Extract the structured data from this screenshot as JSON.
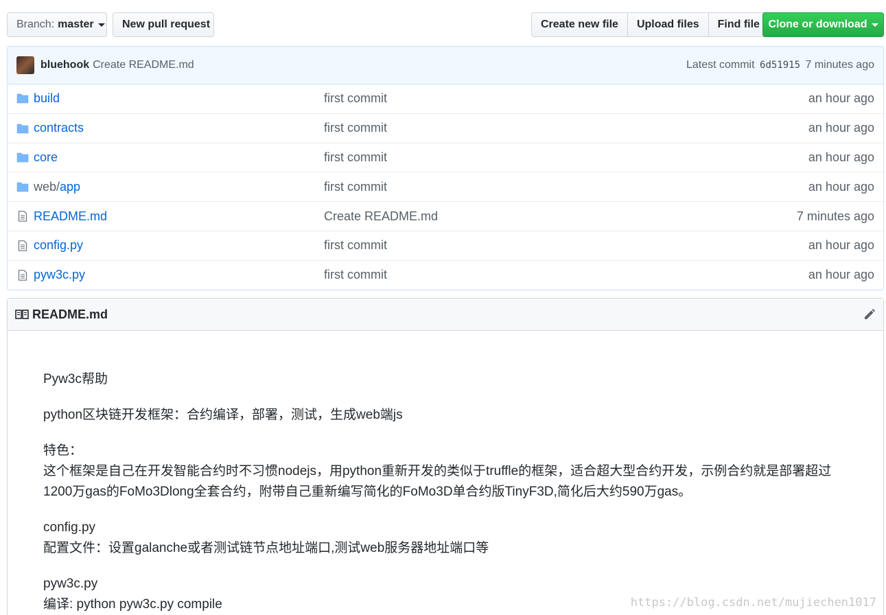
{
  "toolbar": {
    "branch_prefix": "Branch:",
    "branch_name": "master",
    "new_pr": "New pull request",
    "create_file": "Create new file",
    "upload_files": "Upload files",
    "find_file": "Find file",
    "clone": "Clone or download"
  },
  "commit": {
    "author": "bluehook",
    "message": "Create README.md",
    "latest_label": "Latest commit",
    "sha": "6d51915",
    "age": "7 minutes ago"
  },
  "files": [
    {
      "type": "dir",
      "prefix": "",
      "name": "build",
      "message": "first commit",
      "age": "an hour ago"
    },
    {
      "type": "dir",
      "prefix": "",
      "name": "contracts",
      "message": "first commit",
      "age": "an hour ago"
    },
    {
      "type": "dir",
      "prefix": "",
      "name": "core",
      "message": "first commit",
      "age": "an hour ago"
    },
    {
      "type": "dir",
      "prefix": "web/",
      "name": "app",
      "message": "first commit",
      "age": "an hour ago"
    },
    {
      "type": "file",
      "prefix": "",
      "name": "README.md",
      "message": "Create README.md",
      "age": "7 minutes ago"
    },
    {
      "type": "file",
      "prefix": "",
      "name": "config.py",
      "message": "first commit",
      "age": "an hour ago"
    },
    {
      "type": "file",
      "prefix": "",
      "name": "pyw3c.py",
      "message": "first commit",
      "age": "an hour ago"
    }
  ],
  "readme": {
    "title": "README.md",
    "paragraphs": [
      [
        "Pyw3c帮助"
      ],
      [
        "python区块链开发框架：合约编译，部署，测试，生成web端js"
      ],
      [
        "特色：",
        "这个框架是自己在开发智能合约时不习惯nodejs，用python重新开发的类似于truffle的框架，适合超大型合约开发，示例合约就是部署超过1200万gas的FoMo3Dlong全套合约，附带自己重新编写简化的FoMo3D单合约版TinyF3D,简化后大约590万gas。"
      ],
      [
        "config.py",
        "配置文件：设置galanche或者测试链节点地址端口,测试web服务器地址端口等"
      ],
      [
        "pyw3c.py",
        "编译: python pyw3c.py compile"
      ]
    ]
  },
  "watermark": "https://blog.csdn.net/mujiechen1017",
  "icons": {
    "dir": "folder-icon",
    "file": "file-icon"
  },
  "colors": {
    "link": "#0366d6",
    "clone_bg": "#28a745",
    "commit_bg": "#f1f8ff"
  }
}
